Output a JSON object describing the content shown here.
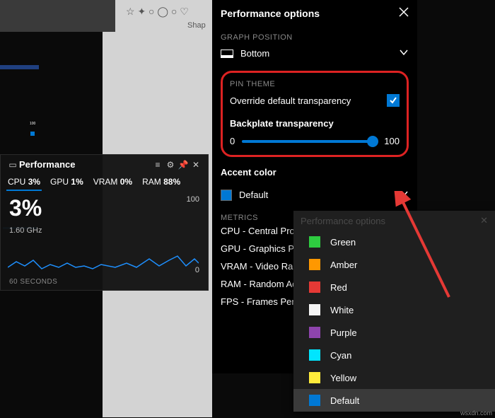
{
  "background": {
    "shape_label": "Shap"
  },
  "perf_widget": {
    "title": "Performance",
    "tabs": {
      "cpu": {
        "label": "CPU",
        "pct": "3%"
      },
      "gpu": {
        "label": "GPU",
        "pct": "1%"
      },
      "vram": {
        "label": "VRAM",
        "pct": "0%"
      },
      "ram": {
        "label": "RAM",
        "pct": "88%"
      }
    },
    "big_pct": "3%",
    "freq": "1.60 GHz",
    "axis_max": "100",
    "axis_min": "0",
    "time_label": "60 SECONDS"
  },
  "options": {
    "title": "Performance options",
    "graph_position": {
      "label": "GRAPH POSITION",
      "value": "Bottom"
    },
    "pin_theme": {
      "label": "PIN THEME",
      "override_label": "Override default transparency",
      "override_checked": true,
      "backplate_label": "Backplate transparency",
      "slider_min": "0",
      "slider_max": "100"
    },
    "accent": {
      "label": "Accent color",
      "value": "Default",
      "swatch": "#0078d4"
    },
    "metrics_label": "METRICS",
    "metrics": {
      "cpu": "CPU - Central Proc",
      "gpu": "GPU - Graphics Pro",
      "vram": "VRAM - Video Ran",
      "ram": "RAM - Random Ac",
      "fps": "FPS - Frames Per S"
    }
  },
  "dropdown": {
    "header": "Performance options",
    "items": {
      "green": {
        "label": "Green",
        "color": "#2ecc40"
      },
      "amber": {
        "label": "Amber",
        "color": "#ff9800"
      },
      "red": {
        "label": "Red",
        "color": "#e53935"
      },
      "white": {
        "label": "White",
        "color": "#f5f5f5"
      },
      "purple": {
        "label": "Purple",
        "color": "#8e44ad"
      },
      "cyan": {
        "label": "Cyan",
        "color": "#00e5ff"
      },
      "yellow": {
        "label": "Yellow",
        "color": "#ffeb3b"
      },
      "default": {
        "label": "Default",
        "color": "#0078d4"
      }
    }
  },
  "mini_100": "100",
  "watermark": "wsxdn.com"
}
